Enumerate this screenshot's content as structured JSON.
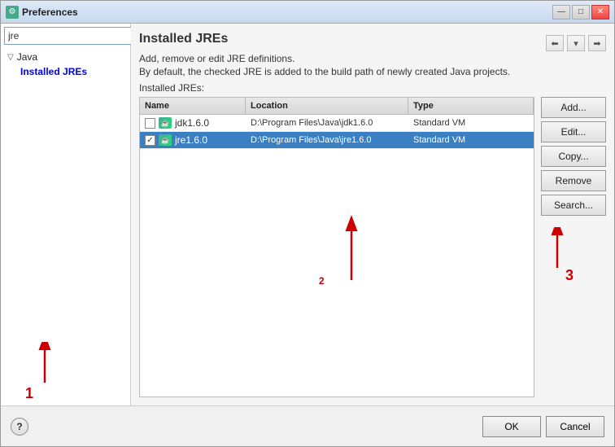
{
  "window": {
    "title": "Preferences",
    "icon": "⚙"
  },
  "title_controls": {
    "minimize": "—",
    "maximize": "□",
    "close": "✕"
  },
  "left_panel": {
    "search_value": "jre",
    "search_placeholder": "",
    "tree": {
      "java_label": "Java",
      "installed_jres_label": "Installed JREs"
    }
  },
  "right_panel": {
    "title": "Installed JREs",
    "description_line1": "Add, remove or edit JRE definitions.",
    "description_line2": "By default, the checked JRE is added to the build path of newly created Java projects.",
    "table_label": "Installed JREs:",
    "columns": {
      "name": "Name",
      "location": "Location",
      "type": "Type"
    },
    "rows": [
      {
        "checked": false,
        "name": "jdk1.6.0",
        "location": "D:\\Program Files\\Java\\jdk1.6.0",
        "type": "Standard VM",
        "selected": false
      },
      {
        "checked": true,
        "name": "jre1.6.0",
        "location": "D:\\Program Files\\Java\\jre1.6.0",
        "type": "Standard VM",
        "selected": true
      }
    ],
    "buttons": {
      "add": "Add...",
      "edit": "Edit...",
      "copy": "Copy...",
      "remove": "Remove",
      "search": "Search..."
    }
  },
  "bottom": {
    "ok": "OK",
    "cancel": "Cancel",
    "help_icon": "?"
  },
  "annotations": {
    "label_1": "1",
    "label_2": "2",
    "label_3": "3"
  }
}
